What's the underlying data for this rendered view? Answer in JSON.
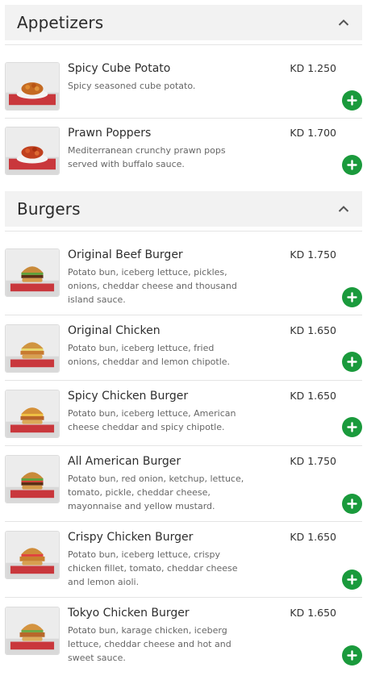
{
  "sections": [
    {
      "title": "Appetizers",
      "items": [
        {
          "name": "Spicy Cube Potato",
          "desc": "Spicy seasoned cube potato.",
          "price": "KD 1.250"
        },
        {
          "name": "Prawn Poppers",
          "desc": "Mediterranean crunchy prawn pops served with buffalo sauce.",
          "price": "KD 1.700"
        }
      ]
    },
    {
      "title": "Burgers",
      "items": [
        {
          "name": "Original Beef Burger",
          "desc": "Potato bun, iceberg lettuce, pickles, onions, cheddar cheese and thousand island sauce.",
          "price": "KD 1.750"
        },
        {
          "name": "Original Chicken",
          "desc": "Potato bun, iceberg lettuce, fried onions, cheddar and lemon chipotle.",
          "price": "KD 1.650"
        },
        {
          "name": "Spicy Chicken Burger",
          "desc": "Potato bun, iceberg lettuce, American cheese cheddar and spicy chipotle.",
          "price": "KD 1.650"
        },
        {
          "name": "All American Burger",
          "desc": "Potato bun, red onion, ketchup, lettuce, tomato, pickle, cheddar cheese, mayonnaise and yellow mustard.",
          "price": "KD 1.750"
        },
        {
          "name": "Crispy Chicken Burger",
          "desc": "Potato bun, iceberg lettuce, crispy chicken fillet, tomato, cheddar cheese and lemon aioli.",
          "price": "KD 1.650"
        },
        {
          "name": "Tokyo Chicken Burger",
          "desc": "Potato bun, karage chicken, iceberg lettuce, cheddar cheese and hot and sweet sauce.",
          "price": "KD 1.650"
        }
      ]
    }
  ],
  "colors": {
    "add_button": "#1a9a3c",
    "header_bg": "#f2f2f2"
  },
  "icons": {
    "collapse": "chevron-up-icon",
    "add": "plus-icon"
  }
}
